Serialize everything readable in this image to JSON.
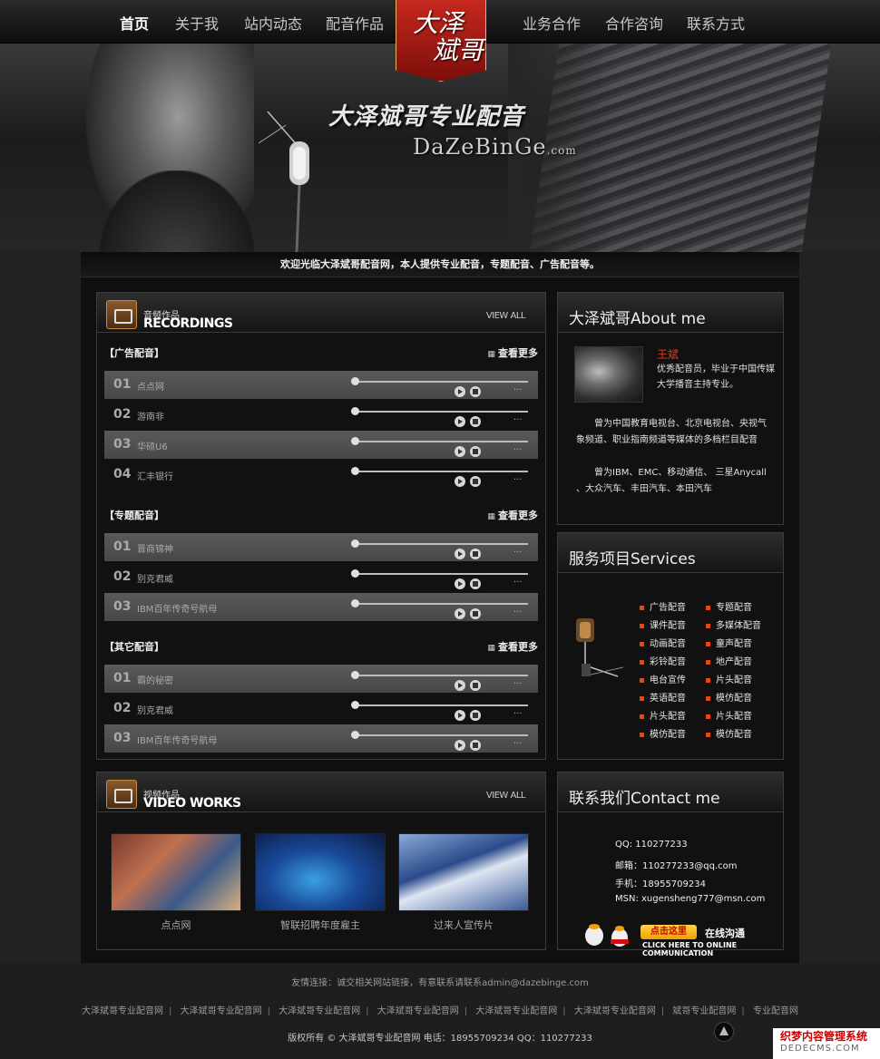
{
  "nav": {
    "left": [
      "首页",
      "关于我",
      "站内动态",
      "配音作品"
    ],
    "right": [
      "业务合作",
      "合作咨询",
      "联系方式"
    ],
    "logo_line1": "大泽",
    "logo_line2": "斌哥"
  },
  "banner": {
    "headline": "大泽斌哥专业配音",
    "site_en": "DaZeBinGe",
    "site_en_suffix": ".com"
  },
  "welcome": "欢迎光临大泽斌哥配音网，本人提供专业配音，专题配音、广告配音等。",
  "recordings": {
    "zh_small": "音频作品",
    "en_big": "RECORDINGS",
    "view_all": "VIEW ALL",
    "more_label": "查看更多",
    "categories": [
      {
        "title": "【广告配音】",
        "tracks": [
          {
            "num": "01",
            "name": "点点网"
          },
          {
            "num": "02",
            "name": "游南非"
          },
          {
            "num": "03",
            "name": "华硕U6"
          },
          {
            "num": "04",
            "name": "汇丰银行"
          }
        ]
      },
      {
        "title": "【专题配音】",
        "tracks": [
          {
            "num": "01",
            "name": "晋商锦神"
          },
          {
            "num": "02",
            "name": "别克君威"
          },
          {
            "num": "03",
            "name": "IBM百年传奇号航母"
          }
        ]
      },
      {
        "title": "【其它配音】",
        "tracks": [
          {
            "num": "01",
            "name": "霸的秘密"
          },
          {
            "num": "02",
            "name": "别克君威"
          },
          {
            "num": "03",
            "name": "IBM百年传奇号航母"
          }
        ]
      }
    ],
    "dots": "..."
  },
  "videos": {
    "zh_small": "视频作品",
    "en_big": "VIDEO WORKS",
    "view_all": "VIEW ALL",
    "items": [
      {
        "caption": "点点网"
      },
      {
        "caption": "智联招聘年度雇主"
      },
      {
        "caption": "过来人宣传片"
      }
    ]
  },
  "about": {
    "title": "大泽斌哥About me",
    "name": "王斌",
    "intro": "优秀配音员，毕业于中国传媒大学播音主持专业。",
    "p1": "曾为中国教育电视台、北京电视台、央视气象频道、职业指南频道等媒体的多档栏目配音",
    "p2": "曾为IBM、EMC、移动通信、 三星Anycall 、大众汽车、丰田汽车、本田汽车"
  },
  "services": {
    "title": "服务项目Services",
    "col1": [
      "广告配音",
      "课件配音",
      "动画配音",
      "彩铃配音",
      "电台宣传",
      "英语配音",
      "片头配音",
      "模仿配音"
    ],
    "col2": [
      "专题配音",
      "多媒体配音",
      "童声配音",
      "地产配音",
      "片头配音",
      "模仿配音",
      "片头配音",
      "模仿配音"
    ]
  },
  "contact": {
    "title": "联系我们Contact me",
    "qq": "QQ: 110277233",
    "email": "邮箱：110277233@qq.com",
    "phone": "手机：18955709234",
    "msn": "MSN: xugensheng777@msn.com",
    "click_btn": "点击这里",
    "online": "在线沟通",
    "online_en": "CLICK HERE TO ONLINE COMMUNICATION"
  },
  "footer": {
    "friend": "友情连接：诚交相关网站链接，有意联系请联系admin@dazebinge.com",
    "links": [
      "大泽斌哥专业配音网",
      "大泽斌哥专业配音网",
      "大泽斌哥专业配音网",
      "大泽斌哥专业配音网",
      "大泽斌哥专业配音网",
      "大泽斌哥专业配音网",
      "斌哥专业配音网",
      "专业配音网"
    ],
    "copyright": "版权所有 © 大泽斌哥专业配音网 电话：18955709234   QQ：110277233",
    "watermark1": "织梦内容管理系统",
    "watermark2": "DEDECMS.COM"
  },
  "colors": {
    "accent_red": "#c6281e",
    "bullet_orange": "#e04a10",
    "name_red": "#e23a1c"
  }
}
